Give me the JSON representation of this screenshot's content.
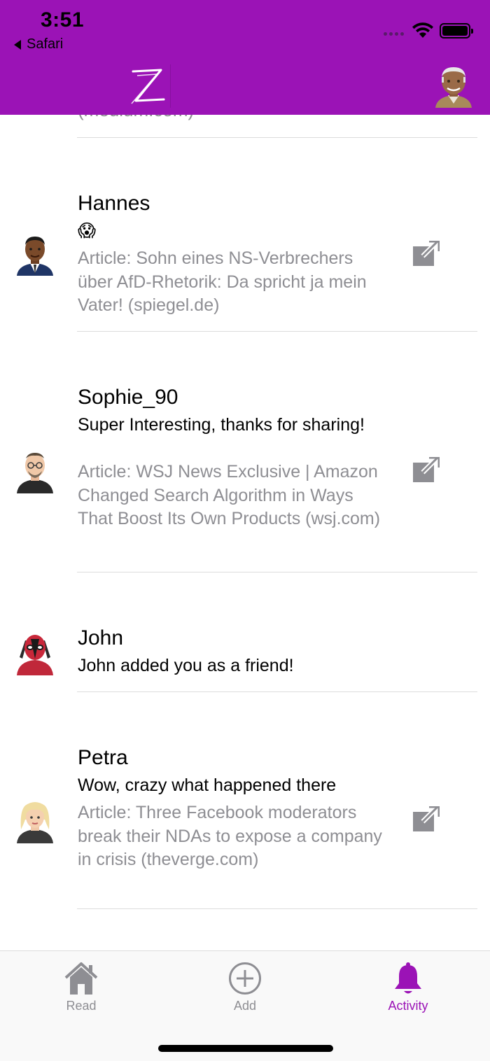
{
  "status_bar": {
    "time": "3:51",
    "back_app": "Safari"
  },
  "header": {
    "logo_letter": "Z",
    "profile_icon": "user-avatar-icon",
    "accent_color": "#9b13b6"
  },
  "feed": {
    "partial_text": "(medium.com)",
    "items": [
      {
        "name": "Hannes",
        "comment": "😱",
        "article": "Article: Sohn eines NS-Verbrechers über AfD-Rhetorik: Da spricht ja mein Vater! (spiegel.de)",
        "has_link": true
      },
      {
        "name": "Sophie_90",
        "comment": "Super Interesting, thanks for sharing!",
        "article": "Article: WSJ News Exclusive | Amazon Changed Search Algorithm in Ways That Boost Its Own Products (wsj.com)",
        "has_link": true
      },
      {
        "name": "John",
        "comment": "John added you as a friend!",
        "article": "",
        "has_link": false
      },
      {
        "name": "Petra",
        "comment": "Wow, crazy what happened there",
        "article": "Article: Three Facebook moderators break their NDAs to expose a company in crisis (theverge.com)",
        "has_link": true
      }
    ]
  },
  "tabbar": {
    "tabs": [
      {
        "label": "Read",
        "icon": "home-icon",
        "active": false
      },
      {
        "label": "Add",
        "icon": "plus-circle-icon",
        "active": false
      },
      {
        "label": "Activity",
        "icon": "bell-icon",
        "active": true
      }
    ]
  }
}
